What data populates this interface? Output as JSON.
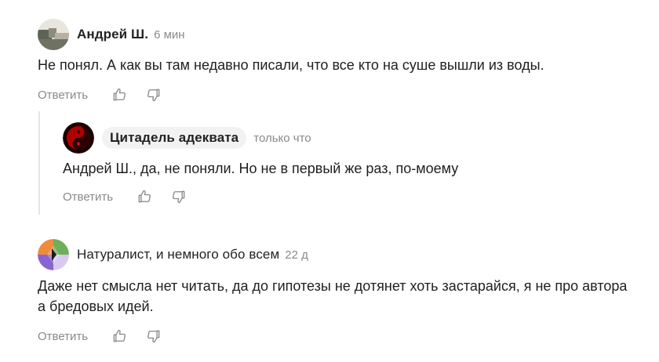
{
  "comments": [
    {
      "author": "Андрей Ш.",
      "time": "6 мин",
      "text": "Не понял. А как вы там недавно писали, что все кто на суше вышли из воды.",
      "reply_label": "Ответить"
    },
    {
      "author": "Цитадель адеквата",
      "time": "только что",
      "text": "Андрей Ш., да, не поняли. Но не в первый же раз, по-моему",
      "reply_label": "Ответить"
    },
    {
      "author": "Натуралист, и немного обо всем",
      "time": "22 д",
      "text": "Даже нет смысла нет читать, да до гипотезы не дотянет хоть застарайся, я не про автора а бредовых идей.",
      "reply_label": "Ответить"
    }
  ],
  "icons": {
    "like": "thumbs-up-icon",
    "dislike": "thumbs-down-icon"
  },
  "colors": {
    "muted_text": "#8a8a8a",
    "pill_bg": "#f2f2f2",
    "thread_line": "#e6e6e6"
  }
}
